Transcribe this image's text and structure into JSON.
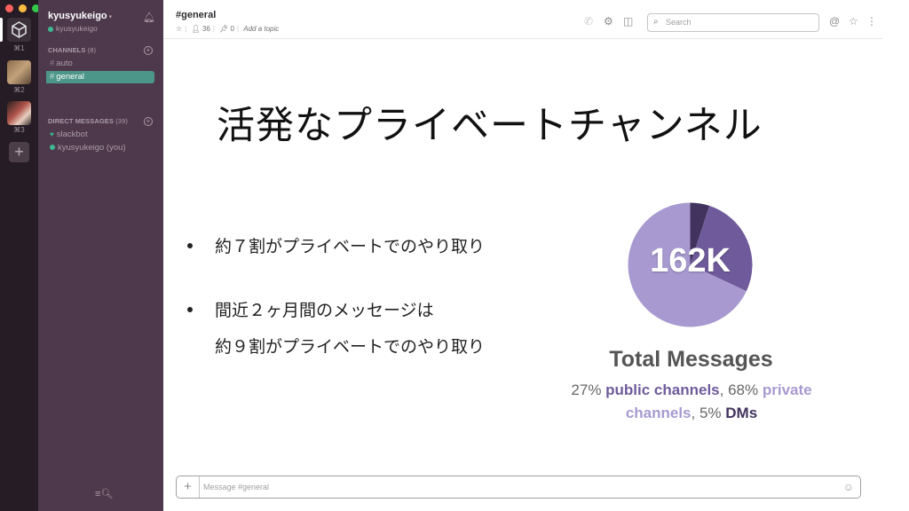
{
  "rail": {
    "keys": [
      "⌘1",
      "⌘2",
      "⌘3"
    ],
    "add_label": "+"
  },
  "sidebar": {
    "team_name": "kyusyukeigo",
    "username": "kyusyukeigo",
    "channels_header": "CHANNELS",
    "channels_count": "(8)",
    "channels": [
      {
        "name": "auto",
        "active": false
      },
      {
        "name": "general",
        "active": true
      }
    ],
    "dm_header": "DIRECT MESSAGES",
    "dm_count": "(39)",
    "dms": [
      {
        "name": "slackbot"
      },
      {
        "name": "kyusyukeigo (you)"
      }
    ]
  },
  "header": {
    "channel": "#general",
    "members": "36",
    "pins": "0",
    "topic": "Add a topic",
    "search_placeholder": "Search"
  },
  "slide": {
    "title": "活発なプライベートチャンネル",
    "bullet1": "約７割がプライベートでのやり取り",
    "bullet2_line1": "間近２ヶ月間のメッセージは",
    "bullet2_line2": "約９割がプライベートでのやり取り"
  },
  "chart_data": {
    "type": "pie",
    "center_label": "162K",
    "title": "Total Messages",
    "slices": [
      {
        "name": "public channels",
        "value": 27,
        "color": "#6f5b9b"
      },
      {
        "name": "private channels",
        "value": 68,
        "color": "#a89ad0"
      },
      {
        "name": "DMs",
        "value": 5,
        "color": "#41335e"
      }
    ],
    "sub_parts": {
      "p1": "27% ",
      "p2": "public channels",
      "p3": ", 68% ",
      "p4": "private channels",
      "p5": ", 5% ",
      "p6": "DMs"
    }
  },
  "composer": {
    "placeholder": "Message #general",
    "plus": "+"
  },
  "colors": {
    "sidebar_bg": "#4d394b",
    "active_channel": "#4c9689",
    "rail_bg": "#261c25"
  }
}
